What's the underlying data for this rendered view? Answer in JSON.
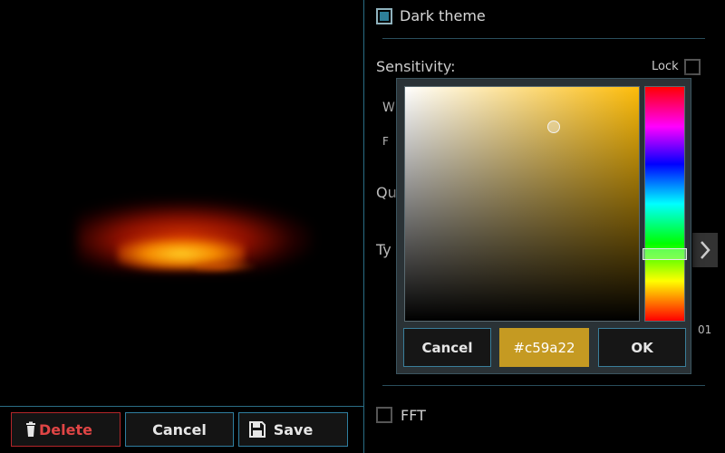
{
  "preview": {
    "flame_colors": [
      "#e63c00",
      "#ffd228",
      "#ff9600"
    ]
  },
  "toolbar": {
    "delete_label": "Delete",
    "cancel_label": "Cancel",
    "save_label": "Save",
    "delete_icon": "trash-icon",
    "save_icon": "floppy-disk-icon",
    "delete_color": "#e04545",
    "accent": "#2f7ea0"
  },
  "settings": {
    "dark_theme": {
      "label": "Dark theme",
      "checked": true
    },
    "sensitivity": {
      "label": "Sensitivity:"
    },
    "lock": {
      "label": "Lock",
      "checked": false
    },
    "partial_labels": {
      "w": "W",
      "f": "F",
      "q": "Qu",
      "ty": "Ty",
      "value": "01"
    },
    "fft": {
      "label": "FFT",
      "checked": false
    }
  },
  "color_picker": {
    "hex_value": "#c59a22",
    "selected_color": "#c59a22",
    "hue_color": "#fdbc0a",
    "hue_level": 0.71,
    "saturation": 0.63,
    "brightness": 0.83,
    "cancel_label": "Cancel",
    "ok_label": "OK"
  }
}
